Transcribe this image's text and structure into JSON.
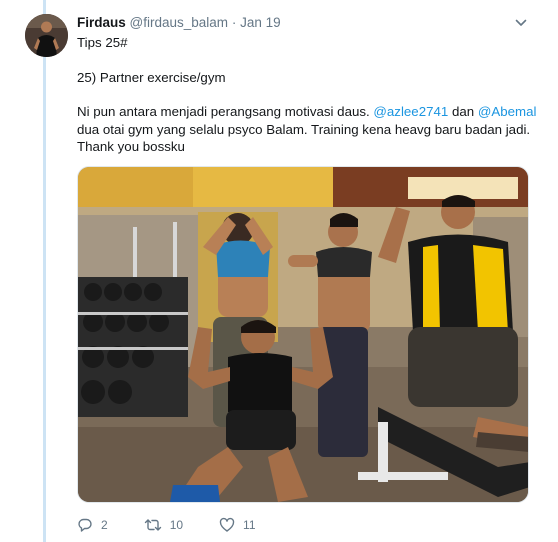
{
  "tweet": {
    "display_name": "Firdaus",
    "handle": "@firdaus_balam",
    "separator": "·",
    "time": "Jan 19",
    "lines": {
      "l1": "Tips 25#",
      "l2": "25) Partner exercise/gym",
      "l3_a": "Ni pun antara menjadi perangsang motivasi daus. ",
      "l3_mention1": "@azlee2741",
      "l3_b": " dan ",
      "l3_mention2": "@Abemal",
      "l4": "dua otai gym yang selalu psyco Balam. Training kena heavg baru badan jadi.",
      "l5": "Thank you bossku"
    }
  },
  "actions": {
    "replies": "2",
    "retweets": "10",
    "likes": "11"
  },
  "icons": {
    "menu": "chevron-down-icon",
    "reply": "reply-icon",
    "retweet": "retweet-icon",
    "like": "heart-icon"
  },
  "colors": {
    "link": "#1b95e0",
    "muted": "#657786",
    "thread_line": "#cde3f4"
  }
}
